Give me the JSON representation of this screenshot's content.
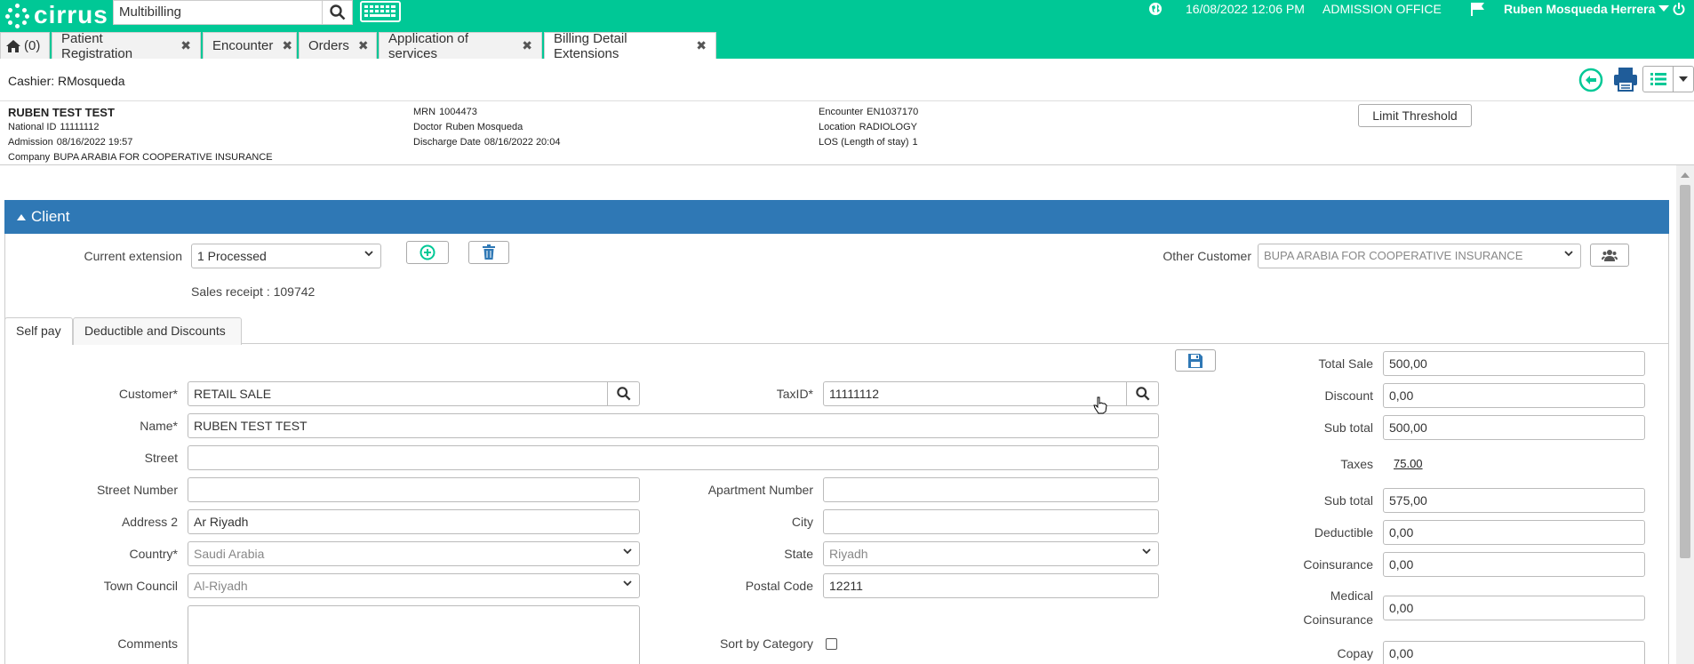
{
  "app": {
    "logo_text": "cirrus",
    "search_value": "Multibilling",
    "datetime": "16/08/2022 12:06 PM",
    "office": "ADMISSION OFFICE",
    "user": "Ruben Mosqueda Herrera"
  },
  "tabs": [
    {
      "label": "(0)"
    },
    {
      "label": "Patient Registration"
    },
    {
      "label": "Encounter"
    },
    {
      "label": "Orders"
    },
    {
      "label": "Application of services"
    },
    {
      "label": "Billing Detail Extensions"
    }
  ],
  "cashier": "Cashier: RMosqueda",
  "patient": {
    "name": "RUBEN TEST TEST",
    "national_id_label": "National ID",
    "national_id": "11111112",
    "admission_label": "Admission",
    "admission": "08/16/2022 19:57",
    "company_label": "Company",
    "company": "BUPA ARABIA FOR COOPERATIVE INSURANCE",
    "mrn_label": "MRN",
    "mrn": "1004473",
    "doctor_label": "Doctor",
    "doctor": "Ruben Mosqueda",
    "discharge_label": "Discharge Date",
    "discharge": "08/16/2022 20:04",
    "encounter_label": "Encounter",
    "encounter": "EN1037170",
    "location_label": "Location",
    "location": "RADIOLOGY",
    "los_label": "LOS (Length of stay)",
    "los": "1",
    "limit_button": "Limit Threshold"
  },
  "panel": {
    "title": "Client",
    "current_extension_label": "Current extension",
    "current_extension_value": "1 Processed",
    "sales_receipt": "Sales receipt : 109742",
    "other_customer_label": "Other Customer",
    "other_customer_value": "BUPA ARABIA FOR COOPERATIVE INSURANCE"
  },
  "subtabs": [
    {
      "label": "Self pay"
    },
    {
      "label": "Deductible and Discounts"
    }
  ],
  "form": {
    "customer_label": "Customer*",
    "customer": "RETAIL SALE",
    "taxid_label": "TaxID*",
    "taxid": "11111112",
    "name_label": "Name*",
    "name": "RUBEN TEST TEST",
    "street_label": "Street",
    "street": "",
    "street_number_label": "Street Number",
    "street_number": "",
    "apartment_label": "Apartment Number",
    "apartment": "",
    "address2_label": "Address 2",
    "address2": "Ar Riyadh",
    "city_label": "City",
    "city": "",
    "country_label": "Country*",
    "country": "Saudi Arabia",
    "state_label": "State",
    "state": "Riyadh",
    "town_label": "Town Council",
    "town": "Al-Riyadh",
    "postal_label": "Postal Code",
    "postal": "12211",
    "comments_label": "Comments",
    "comments": "",
    "sort_label": "Sort by Category"
  },
  "totals": {
    "total_sale_label": "Total Sale",
    "total_sale": "500,00",
    "discount_label": "Discount",
    "discount": "0,00",
    "subtotal1_label": "Sub total",
    "subtotal1": "500,00",
    "taxes_label": "Taxes",
    "taxes": "75.00",
    "subtotal2_label": "Sub total",
    "subtotal2": "575,00",
    "deductible_label": "Deductible",
    "deductible": "0,00",
    "coinsurance_label": "Coinsurance",
    "coinsurance": "0,00",
    "medical_coins_label1": "Medical",
    "medical_coins_label2": "Coinsurance",
    "medical_coins": "0,00",
    "copay_label": "Copay",
    "copay": "0,00"
  },
  "colors": {
    "brand": "#00c896",
    "panel": "#2f78b5"
  }
}
